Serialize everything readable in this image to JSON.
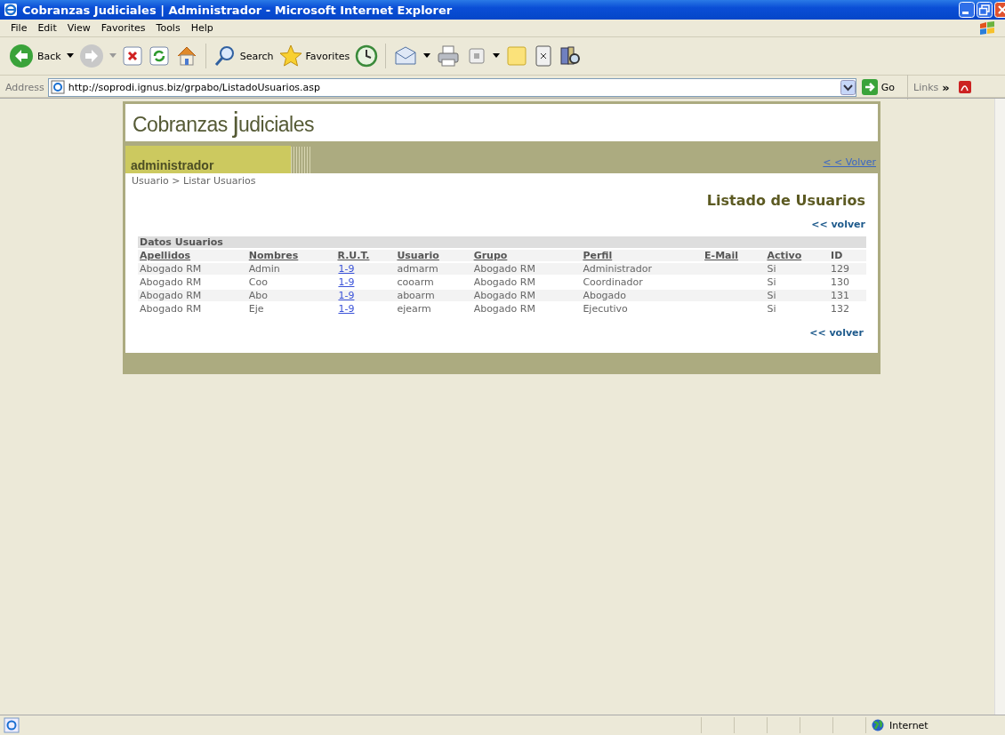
{
  "window": {
    "title": "Cobranzas Judiciales | Administrador - Microsoft Internet Explorer"
  },
  "menu": [
    "File",
    "Edit",
    "View",
    "Favorites",
    "Tools",
    "Help"
  ],
  "toolbar": {
    "back": "Back",
    "search": "Search",
    "favorites": "Favorites"
  },
  "address_bar": {
    "label": "Address",
    "url": "http://soprodi.ignus.biz/grpabo/ListadoUsuarios.asp",
    "go": "Go",
    "links": "Links",
    "more": "»"
  },
  "page": {
    "logo_start": "Cobranzas ",
    "logo_j": "j",
    "logo_end": "udiciales",
    "role": "administrador",
    "back_link": "< < Volver",
    "breadcrumb": "Usuario >  Listar Usuarios",
    "heading": "Listado de Usuarios",
    "volver_top": "<< volver",
    "volver_bottom": "<< volver",
    "table": {
      "caption": "Datos Usuarios",
      "columns": [
        {
          "label": "Apellidos",
          "kind": "text",
          "underlined": true
        },
        {
          "label": "Nombres",
          "kind": "text",
          "underlined": true
        },
        {
          "label": "R.U.T.",
          "kind": "link",
          "underlined": true
        },
        {
          "label": "Usuario",
          "kind": "text",
          "underlined": true
        },
        {
          "label": "Grupo",
          "kind": "text",
          "underlined": true
        },
        {
          "label": "Perfil",
          "kind": "text",
          "underlined": true
        },
        {
          "label": "E-Mail",
          "kind": "text",
          "underlined": true
        },
        {
          "label": "Activo",
          "kind": "text",
          "underlined": true
        },
        {
          "label": "ID",
          "kind": "text",
          "underlined": false
        }
      ],
      "rows": [
        [
          "Abogado RM",
          "Admin",
          "1-9",
          "admarm",
          "Abogado RM",
          "Administrador",
          "",
          "Si",
          "129"
        ],
        [
          "Abogado RM",
          "Coo",
          "1-9",
          "cooarm",
          "Abogado RM",
          "Coordinador",
          "",
          "Si",
          "130"
        ],
        [
          "Abogado RM",
          "Abo",
          "1-9",
          "aboarm",
          "Abogado RM",
          "Abogado",
          "",
          "Si",
          "131"
        ],
        [
          "Abogado RM",
          "Eje",
          "1-9",
          "ejearm",
          "Abogado RM",
          "Ejecutivo",
          "",
          "Si",
          "132"
        ]
      ]
    }
  },
  "status_bar": {
    "zone": "Internet"
  }
}
